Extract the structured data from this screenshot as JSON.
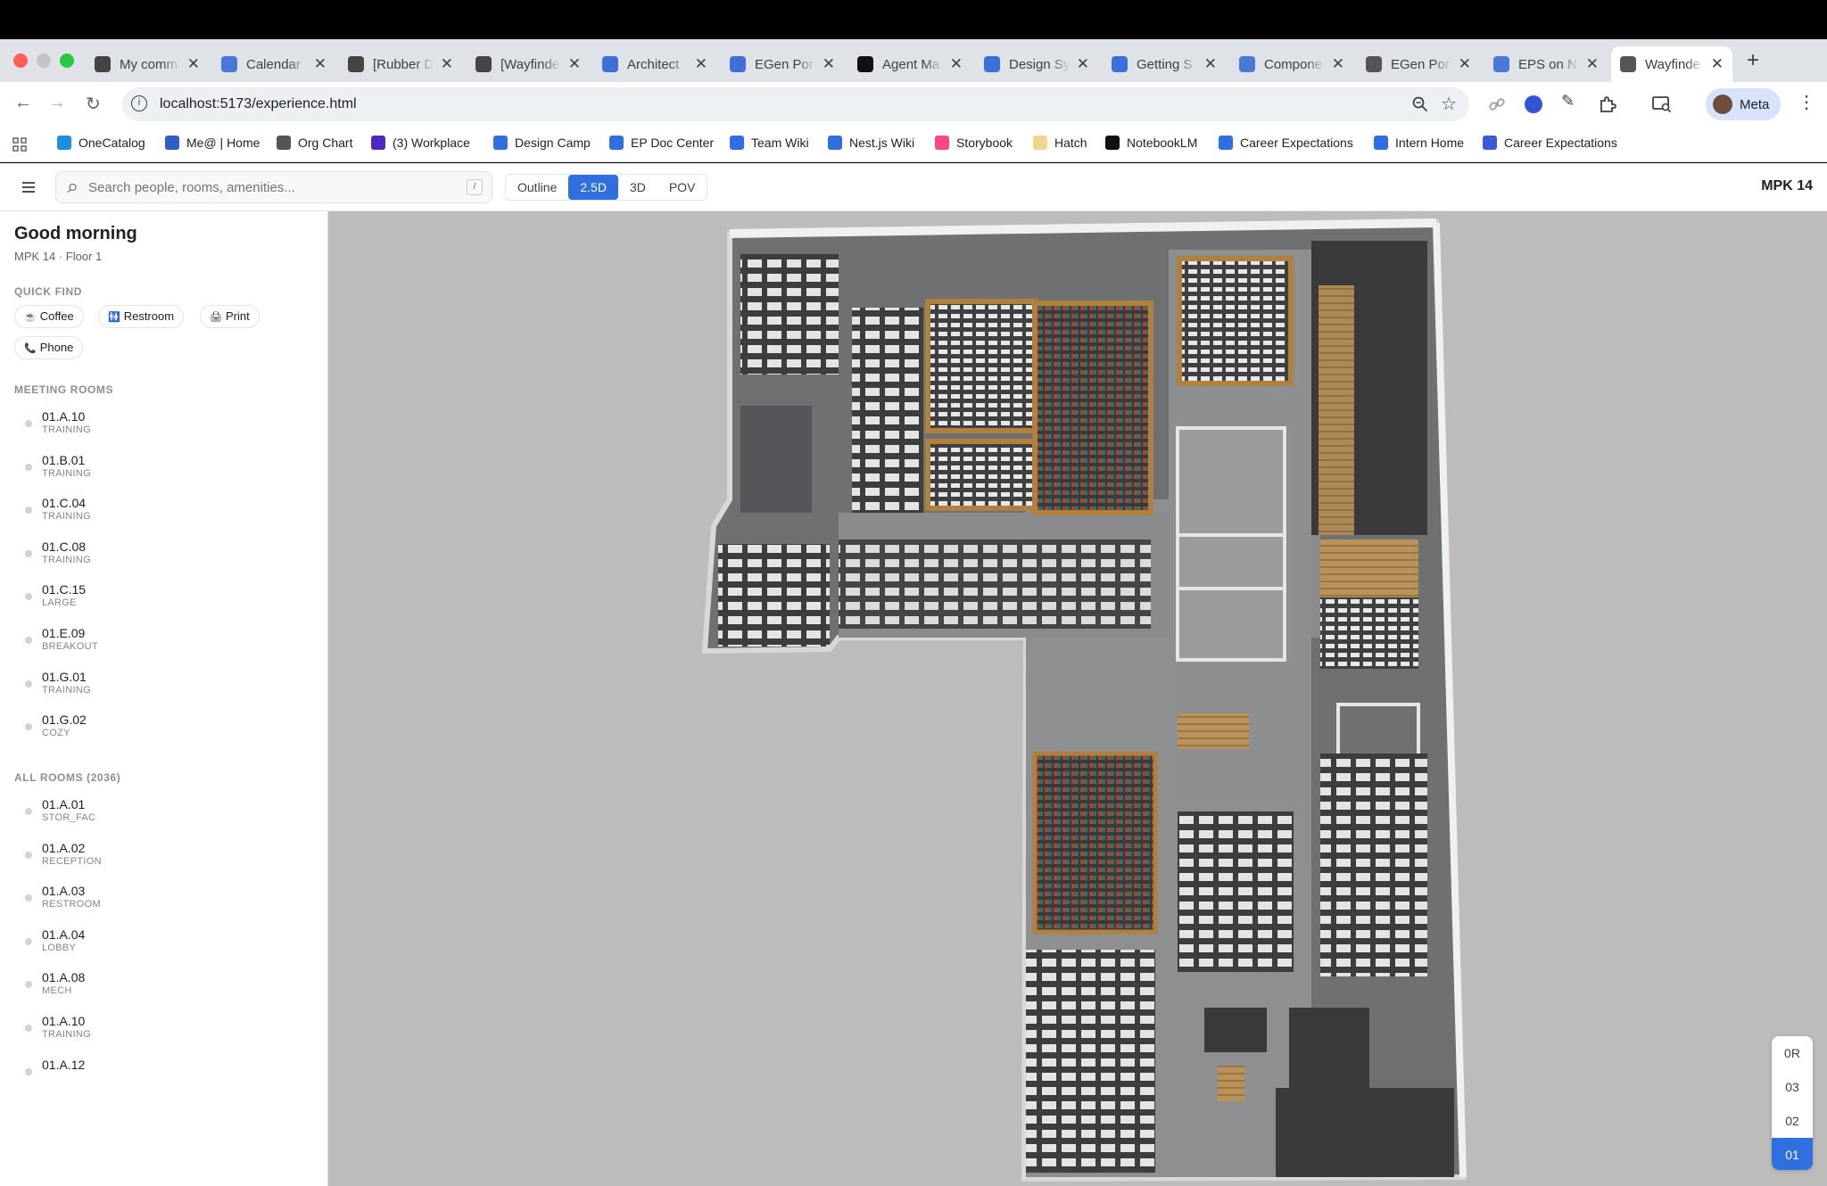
{
  "browser": {
    "tabs": [
      {
        "title": "My comm",
        "icon": "github-icon",
        "color": "#444"
      },
      {
        "title": "Calendar",
        "icon": "calendar-icon",
        "color": "#4a78d8"
      },
      {
        "title": "[Rubber D",
        "icon": "github-icon",
        "color": "#444"
      },
      {
        "title": "[Wayfinde",
        "icon": "github-icon",
        "color": "#444"
      },
      {
        "title": "Architect",
        "icon": "doc-icon",
        "color": "#3f6fd8"
      },
      {
        "title": "EGen Por",
        "icon": "page-icon",
        "color": "#3f6fd8"
      },
      {
        "title": "Agent Ma",
        "icon": "agent-icon",
        "color": "#111"
      },
      {
        "title": "Design Sy",
        "icon": "page-icon",
        "color": "#3f6fd8"
      },
      {
        "title": "Getting S",
        "icon": "doc-icon",
        "color": "#3f6fd8"
      },
      {
        "title": "Compone",
        "icon": "component-icon",
        "color": "#4a78d8"
      },
      {
        "title": "EGen Por",
        "icon": "globe-icon",
        "color": "#555"
      },
      {
        "title": "EPS on N",
        "icon": "component-icon",
        "color": "#4a78d8"
      },
      {
        "title": "Wayfinde",
        "icon": "globe-icon",
        "color": "#555",
        "active": true
      }
    ],
    "url": "localhost:5173/experience.html",
    "profile_label": "Meta",
    "bookmarks": [
      {
        "label": "OneCatalog",
        "color": "#1e8fe0"
      },
      {
        "label": "Me@ | Home",
        "color": "#2d5fc4"
      },
      {
        "label": "Org Chart",
        "color": "#555"
      },
      {
        "label": "(3) Workplace",
        "color": "#4b2bbf"
      },
      {
        "label": "Design Camp",
        "color": "#2f6fe0"
      },
      {
        "label": "EP Doc Center",
        "color": "#2f6fe0"
      },
      {
        "label": "Team Wiki",
        "color": "#2f6fe0"
      },
      {
        "label": "Nest.js Wiki",
        "color": "#2f6fe0"
      },
      {
        "label": "Storybook",
        "color": "#ff4785"
      },
      {
        "label": "Hatch",
        "color": "#f0d58c"
      },
      {
        "label": "NotebookLM",
        "color": "#111"
      },
      {
        "label": "Career Expectations",
        "color": "#2f6fe0"
      },
      {
        "label": "Intern Home",
        "color": "#2f6fe0"
      },
      {
        "label": "Career Expectations",
        "color": "#3b5bd6"
      }
    ]
  },
  "app": {
    "search_placeholder": "Search people, rooms, amenities...",
    "search_shortcut": "/",
    "view_modes": [
      "Outline",
      "2.5D",
      "3D",
      "POV"
    ],
    "selected_mode": "2.5D",
    "building": "MPK 14",
    "accent": "#2f6fe0"
  },
  "sidebar": {
    "greeting": "Good morning",
    "location": "MPK 14 · Floor 1",
    "quick_find_title": "QUICK FIND",
    "quick_find": [
      {
        "label": "Coffee",
        "icon": "☕"
      },
      {
        "label": "Restroom",
        "icon": "🚻"
      },
      {
        "label": "Print",
        "icon": "🖨"
      },
      {
        "label": "Phone",
        "icon": "📞"
      }
    ],
    "meeting_rooms_title": "MEETING ROOMS",
    "meeting_rooms": [
      {
        "id": "01.A.10",
        "type": "TRAINING"
      },
      {
        "id": "01.B.01",
        "type": "TRAINING"
      },
      {
        "id": "01.C.04",
        "type": "TRAINING"
      },
      {
        "id": "01.C.08",
        "type": "TRAINING"
      },
      {
        "id": "01.C.15",
        "type": "LARGE"
      },
      {
        "id": "01.E.09",
        "type": "BREAKOUT"
      },
      {
        "id": "01.G.01",
        "type": "TRAINING"
      },
      {
        "id": "01.G.02",
        "type": "COZY"
      }
    ],
    "all_rooms_title": "ALL ROOMS (2036)",
    "all_rooms": [
      {
        "id": "01.A.01",
        "type": "STOR_FAC"
      },
      {
        "id": "01.A.02",
        "type": "RECEPTION"
      },
      {
        "id": "01.A.03",
        "type": "RESTROOM"
      },
      {
        "id": "01.A.04",
        "type": "LOBBY"
      },
      {
        "id": "01.A.08",
        "type": "MECH"
      },
      {
        "id": "01.A.10",
        "type": "TRAINING"
      },
      {
        "id": "01.A.12",
        "type": ""
      }
    ]
  },
  "floors": {
    "levels": [
      "0R",
      "03",
      "02",
      "01"
    ],
    "selected": "01"
  }
}
